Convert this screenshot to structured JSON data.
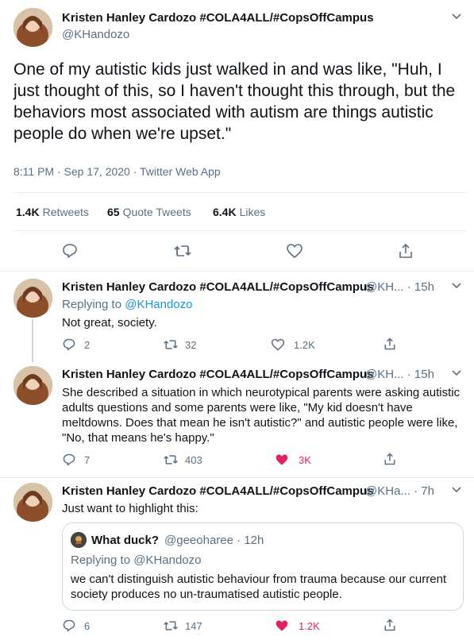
{
  "main_tweet": {
    "author_name": "Kristen Hanley Cardozo #COLA4ALL/#CopsOffCampus",
    "author_handle": "@KHandozo",
    "text": "One of my autistic kids just walked in and was like, \"Huh, I just thought of this, so I haven't thought this through, but the behaviors most associated with autism are things autistic people do when we're upset.\"",
    "meta": "8:11 PM · Sep 17, 2020 · Twitter Web App",
    "retweets_count": "1.4K",
    "retweets_label": "Retweets",
    "quote_count": "65",
    "quote_label": "Quote Tweets",
    "likes_count": "6.4K",
    "likes_label": "Likes"
  },
  "replies": [
    {
      "author_name": "Kristen Hanley Cardozo #COLA4ALL/#CopsOffCampus",
      "handle_time": "@KH... · 15h",
      "replying_label": "Replying to",
      "replying_handle": "@KHandozo",
      "text": "Not great, society.",
      "reply_count": "2",
      "retweet_count": "32",
      "like_count": "1.2K"
    },
    {
      "author_name": "Kristen Hanley Cardozo #COLA4ALL/#CopsOffCampus",
      "handle_time": "@KH... · 15h",
      "text": "She described a situation in which neurotypical parents were asking autistic adults questions and some parents were like, \"My kid doesn't have meltdowns. Does that mean he isn't autistic?\" and autistic people were like, \"No, that means he's happy.\"",
      "reply_count": "7",
      "retweet_count": "403",
      "like_count": "3K"
    },
    {
      "author_name": "Kristen Hanley Cardozo #COLA4ALL/#CopsOffCampus",
      "handle_time": "@KHa... · 7h",
      "text": "Just want to highlight this:",
      "quote": {
        "author_name": "What duck?",
        "handle_time": "@geeoharee · 12h",
        "replying": "Replying to @KHandozo",
        "text": "we can't distinguish autistic behaviour from trauma because our current society produces no un-traumatised autistic people."
      },
      "reply_count": "6",
      "retweet_count": "147",
      "like_count": "1.2K"
    }
  ],
  "colors": {
    "link": "#1b95e0",
    "muted": "#5b7083",
    "liked": "#e0245e",
    "border": "#e6ecf0"
  },
  "icons": [
    "chevron-down-icon",
    "reply-icon",
    "retweet-icon",
    "like-icon",
    "share-icon"
  ]
}
